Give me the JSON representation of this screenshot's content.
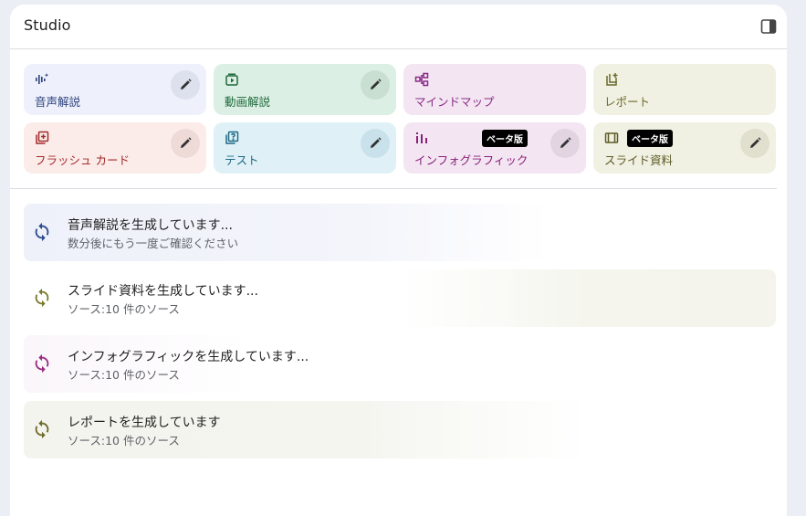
{
  "header": {
    "title": "Studio",
    "toggle_icon": "side-panel-icon"
  },
  "colors": {
    "audio_bg": "#eef1fb",
    "audio_fg": "#2c3f7c",
    "video_bg": "#dcefe4",
    "video_fg": "#1e6a3b",
    "mindmap_bg": "#f3e6f2",
    "mindmap_fg": "#8a2a86",
    "report_bg": "#f1f1e3",
    "report_fg": "#6b6a2b",
    "flash_bg": "#fbecea",
    "flash_fg": "#a32a2a",
    "quiz_bg": "#dff1f7",
    "quiz_fg": "#1f6a85",
    "info_bg": "#f3e6f2",
    "info_fg": "#8a1f7a",
    "slide_bg": "#f1f1e3",
    "slide_fg": "#5d5a26"
  },
  "tools": [
    {
      "label": "音声解説",
      "icon": "audio-waveform-icon"
    },
    {
      "label": "動画解説",
      "icon": "video-play-icon"
    },
    {
      "label": "マインドマップ",
      "icon": "mind-map-icon"
    },
    {
      "label": "レポート",
      "icon": "report-add-icon"
    },
    {
      "label": "フラッシュ カード",
      "icon": "flashcard-icon"
    },
    {
      "label": "テスト",
      "icon": "quiz-icon"
    },
    {
      "label": "インフォグラフィック",
      "icon": "infographic-icon",
      "badge": "ベータ版"
    },
    {
      "label": "スライド資料",
      "icon": "slides-icon",
      "badge": "ベータ版"
    }
  ],
  "generating": [
    {
      "title": "音声解説を生成しています...",
      "subtitle": "数分後にもう一度ご確認ください"
    },
    {
      "title": "スライド資料を生成しています...",
      "subtitle": "ソース:10 件のソース"
    },
    {
      "title": "インフォグラフィックを生成しています...",
      "subtitle": "ソース:10 件のソース"
    },
    {
      "title": "レポートを生成しています",
      "subtitle": "ソース:10 件のソース"
    }
  ]
}
